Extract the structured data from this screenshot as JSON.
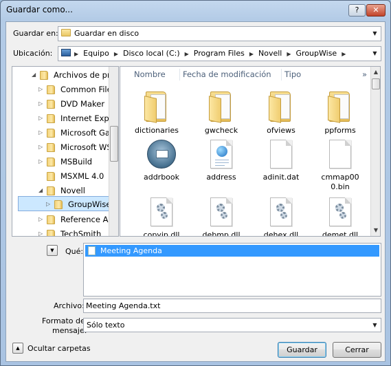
{
  "window": {
    "title": "Guardar como...",
    "help_label": "?",
    "close_label": "✕"
  },
  "save_in": {
    "label": "Guardar en:",
    "value": "Guardar en disco"
  },
  "location": {
    "label": "Ubicación:",
    "crumbs": [
      "Equipo",
      "Disco local (C:)",
      "Program Files",
      "Novell",
      "GroupWise"
    ]
  },
  "tree": {
    "items": [
      {
        "label": "Archivos de pro",
        "expanded": true
      },
      {
        "label": "Common Files"
      },
      {
        "label": "DVD Maker"
      },
      {
        "label": "Internet Explorer"
      },
      {
        "label": "Microsoft Games"
      },
      {
        "label": "Microsoft WSE"
      },
      {
        "label": "MSBuild"
      },
      {
        "label": "MSXML 4.0"
      },
      {
        "label": "Novell",
        "expanded": true
      },
      {
        "label": "GroupWise",
        "selected": true
      },
      {
        "label": "Reference Assemblies"
      },
      {
        "label": "TechSmith"
      }
    ]
  },
  "columns": {
    "name": "Nombre",
    "modified": "Fecha de modificación",
    "type": "Tipo",
    "more": "»"
  },
  "files": [
    {
      "name": "dictionaries",
      "icon": "folder-icon"
    },
    {
      "name": "gwcheck",
      "icon": "folder-icon"
    },
    {
      "name": "ofviews",
      "icon": "folder-icon"
    },
    {
      "name": "ppforms",
      "icon": "folder-icon"
    },
    {
      "name": "addrbook",
      "icon": "addressbook-icon"
    },
    {
      "name": "address",
      "icon": "html-document-icon"
    },
    {
      "name": "adinit.dat",
      "icon": "blank-document-icon"
    },
    {
      "name": "cmmap000.bin",
      "icon": "blank-document-icon"
    },
    {
      "name": "copyip.dll",
      "icon": "dll-icon"
    },
    {
      "name": "debmp.dll",
      "icon": "dll-icon"
    },
    {
      "name": "dehex.dll",
      "icon": "dll-icon"
    },
    {
      "name": "demet.dll",
      "icon": "dll-icon"
    }
  ],
  "what": {
    "label": "Qué:",
    "selected_item": "Meeting Agenda"
  },
  "filename": {
    "label": "Archivo:",
    "value": "Meeting Agenda.txt"
  },
  "format": {
    "label_line1": "Formato del",
    "label_line2": "mensaje:",
    "value": "Sólo texto"
  },
  "hide_folders": {
    "label": "Ocultar carpetas"
  },
  "buttons": {
    "save": "Guardar",
    "cancel": "Cerrar"
  }
}
